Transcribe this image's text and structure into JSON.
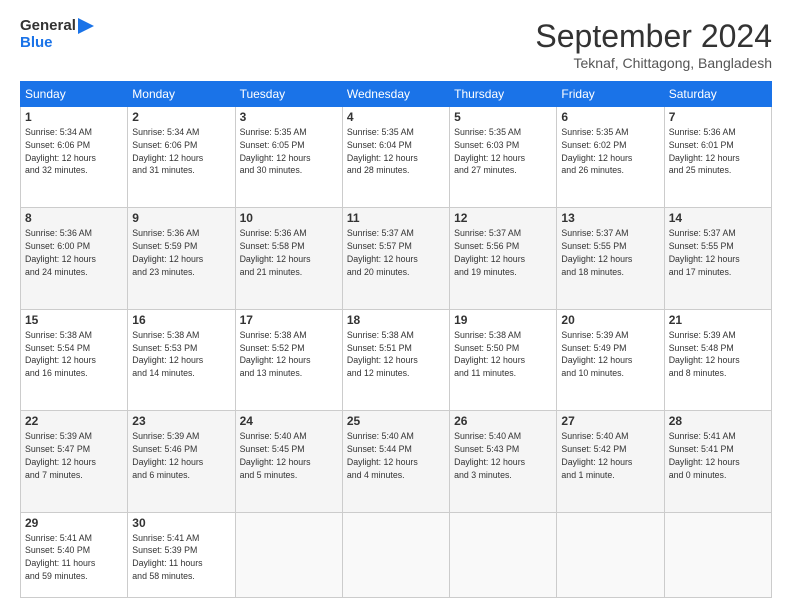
{
  "header": {
    "logo_line1": "General",
    "logo_line2": "Blue",
    "month": "September 2024",
    "location": "Teknaf, Chittagong, Bangladesh"
  },
  "weekdays": [
    "Sunday",
    "Monday",
    "Tuesday",
    "Wednesday",
    "Thursday",
    "Friday",
    "Saturday"
  ],
  "weeks": [
    [
      {
        "day": "1",
        "info": "Sunrise: 5:34 AM\nSunset: 6:06 PM\nDaylight: 12 hours\nand 32 minutes."
      },
      {
        "day": "2",
        "info": "Sunrise: 5:34 AM\nSunset: 6:06 PM\nDaylight: 12 hours\nand 31 minutes."
      },
      {
        "day": "3",
        "info": "Sunrise: 5:35 AM\nSunset: 6:05 PM\nDaylight: 12 hours\nand 30 minutes."
      },
      {
        "day": "4",
        "info": "Sunrise: 5:35 AM\nSunset: 6:04 PM\nDaylight: 12 hours\nand 28 minutes."
      },
      {
        "day": "5",
        "info": "Sunrise: 5:35 AM\nSunset: 6:03 PM\nDaylight: 12 hours\nand 27 minutes."
      },
      {
        "day": "6",
        "info": "Sunrise: 5:35 AM\nSunset: 6:02 PM\nDaylight: 12 hours\nand 26 minutes."
      },
      {
        "day": "7",
        "info": "Sunrise: 5:36 AM\nSunset: 6:01 PM\nDaylight: 12 hours\nand 25 minutes."
      }
    ],
    [
      {
        "day": "8",
        "info": "Sunrise: 5:36 AM\nSunset: 6:00 PM\nDaylight: 12 hours\nand 24 minutes."
      },
      {
        "day": "9",
        "info": "Sunrise: 5:36 AM\nSunset: 5:59 PM\nDaylight: 12 hours\nand 23 minutes."
      },
      {
        "day": "10",
        "info": "Sunrise: 5:36 AM\nSunset: 5:58 PM\nDaylight: 12 hours\nand 21 minutes."
      },
      {
        "day": "11",
        "info": "Sunrise: 5:37 AM\nSunset: 5:57 PM\nDaylight: 12 hours\nand 20 minutes."
      },
      {
        "day": "12",
        "info": "Sunrise: 5:37 AM\nSunset: 5:56 PM\nDaylight: 12 hours\nand 19 minutes."
      },
      {
        "day": "13",
        "info": "Sunrise: 5:37 AM\nSunset: 5:55 PM\nDaylight: 12 hours\nand 18 minutes."
      },
      {
        "day": "14",
        "info": "Sunrise: 5:37 AM\nSunset: 5:55 PM\nDaylight: 12 hours\nand 17 minutes."
      }
    ],
    [
      {
        "day": "15",
        "info": "Sunrise: 5:38 AM\nSunset: 5:54 PM\nDaylight: 12 hours\nand 16 minutes."
      },
      {
        "day": "16",
        "info": "Sunrise: 5:38 AM\nSunset: 5:53 PM\nDaylight: 12 hours\nand 14 minutes."
      },
      {
        "day": "17",
        "info": "Sunrise: 5:38 AM\nSunset: 5:52 PM\nDaylight: 12 hours\nand 13 minutes."
      },
      {
        "day": "18",
        "info": "Sunrise: 5:38 AM\nSunset: 5:51 PM\nDaylight: 12 hours\nand 12 minutes."
      },
      {
        "day": "19",
        "info": "Sunrise: 5:38 AM\nSunset: 5:50 PM\nDaylight: 12 hours\nand 11 minutes."
      },
      {
        "day": "20",
        "info": "Sunrise: 5:39 AM\nSunset: 5:49 PM\nDaylight: 12 hours\nand 10 minutes."
      },
      {
        "day": "21",
        "info": "Sunrise: 5:39 AM\nSunset: 5:48 PM\nDaylight: 12 hours\nand 8 minutes."
      }
    ],
    [
      {
        "day": "22",
        "info": "Sunrise: 5:39 AM\nSunset: 5:47 PM\nDaylight: 12 hours\nand 7 minutes."
      },
      {
        "day": "23",
        "info": "Sunrise: 5:39 AM\nSunset: 5:46 PM\nDaylight: 12 hours\nand 6 minutes."
      },
      {
        "day": "24",
        "info": "Sunrise: 5:40 AM\nSunset: 5:45 PM\nDaylight: 12 hours\nand 5 minutes."
      },
      {
        "day": "25",
        "info": "Sunrise: 5:40 AM\nSunset: 5:44 PM\nDaylight: 12 hours\nand 4 minutes."
      },
      {
        "day": "26",
        "info": "Sunrise: 5:40 AM\nSunset: 5:43 PM\nDaylight: 12 hours\nand 3 minutes."
      },
      {
        "day": "27",
        "info": "Sunrise: 5:40 AM\nSunset: 5:42 PM\nDaylight: 12 hours\nand 1 minute."
      },
      {
        "day": "28",
        "info": "Sunrise: 5:41 AM\nSunset: 5:41 PM\nDaylight: 12 hours\nand 0 minutes."
      }
    ],
    [
      {
        "day": "29",
        "info": "Sunrise: 5:41 AM\nSunset: 5:40 PM\nDaylight: 11 hours\nand 59 minutes."
      },
      {
        "day": "30",
        "info": "Sunrise: 5:41 AM\nSunset: 5:39 PM\nDaylight: 11 hours\nand 58 minutes."
      },
      null,
      null,
      null,
      null,
      null
    ]
  ]
}
